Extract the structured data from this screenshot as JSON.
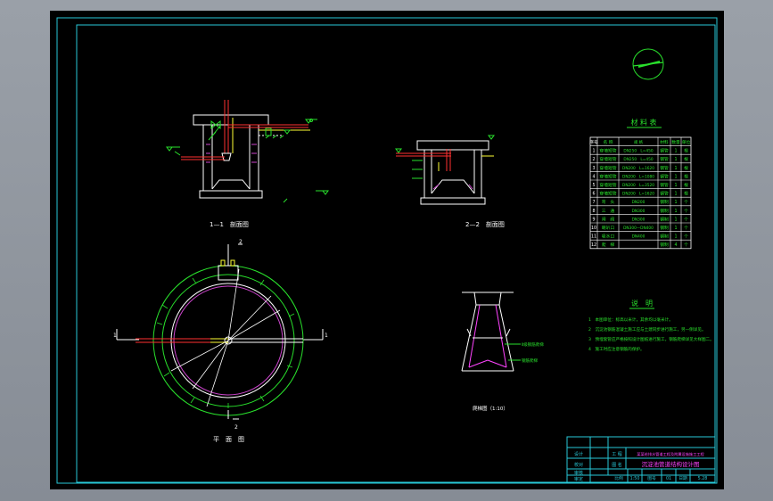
{
  "drawing": {
    "view_labels": {
      "section_1_1": "1—1　剖面图",
      "section_2_2": "2—2　剖面图",
      "plan": "平　面　图",
      "ladder_detail": "爬梯图（1:10）"
    },
    "section_markers": {
      "one": "1",
      "two": "2"
    },
    "detail_callouts": [
      "Ⅱ级钢筋爬梯",
      "钢筋爬梯"
    ],
    "materials_table": {
      "title": "材 料 表",
      "headers": [
        "序号",
        "名 称",
        "规 格",
        "材料",
        "数量",
        "单位"
      ],
      "rows": [
        [
          "1",
          "穿墙短管",
          "DN250　L=450",
          "钢管",
          "1",
          "根"
        ],
        [
          "2",
          "穿墙短管",
          "DN250　L=450",
          "钢管",
          "1",
          "根"
        ],
        [
          "3",
          "穿墙短管",
          "DN200　L=1620",
          "钢管",
          "1",
          "根"
        ],
        [
          "4",
          "穿墙短管",
          "DN200　L=1080",
          "钢管",
          "1",
          "根"
        ],
        [
          "5",
          "穿墙短管",
          "DN200　L=3520",
          "钢管",
          "1",
          "根"
        ],
        [
          "6",
          "穿墙短管",
          "DN200　L=1620",
          "钢管",
          "1",
          "根"
        ],
        [
          "7",
          "弯　头",
          "DN200",
          "钢制",
          "1",
          "个"
        ],
        [
          "8",
          "三　通",
          "DN300",
          "钢制",
          "1",
          "个"
        ],
        [
          "9",
          "闸　阀",
          "DN300",
          "钢制",
          "1",
          "个"
        ],
        [
          "10",
          "喇叭口",
          "DN300—DN400",
          "钢制",
          "1",
          "个"
        ],
        [
          "11",
          "吸水口",
          "DN400",
          "钢制",
          "1",
          "个"
        ],
        [
          "12",
          "爬　梯",
          "",
          "钢制",
          "4",
          "个"
        ]
      ]
    },
    "notes": {
      "title": "说　明",
      "items": [
        "1　本图单位：标高以米计，其余均以毫米计。",
        "2　沉淀池钢筋混凝土施工应与土建同步进行施工，另一侧详见。",
        "3　预埋套管应严格按照设计图纸进行施工，钢筋爬梯详见大样图二。",
        "4　施工时应注意钢筋的保护。"
      ]
    },
    "title_block": {
      "left_labels": [
        "设计",
        "校对",
        "审核",
        "审定"
      ],
      "project_label": "工 程",
      "project_name": "某某给排水管道工程及附属设施施工工程",
      "drawing_label": "图 名",
      "drawing_name": "沉淀池管道结构设计图",
      "scale_label": "比例",
      "scale_value": "1:50",
      "number_label": "图号",
      "number_value": "01",
      "date_label": "日期",
      "date_value": "5.28"
    }
  }
}
